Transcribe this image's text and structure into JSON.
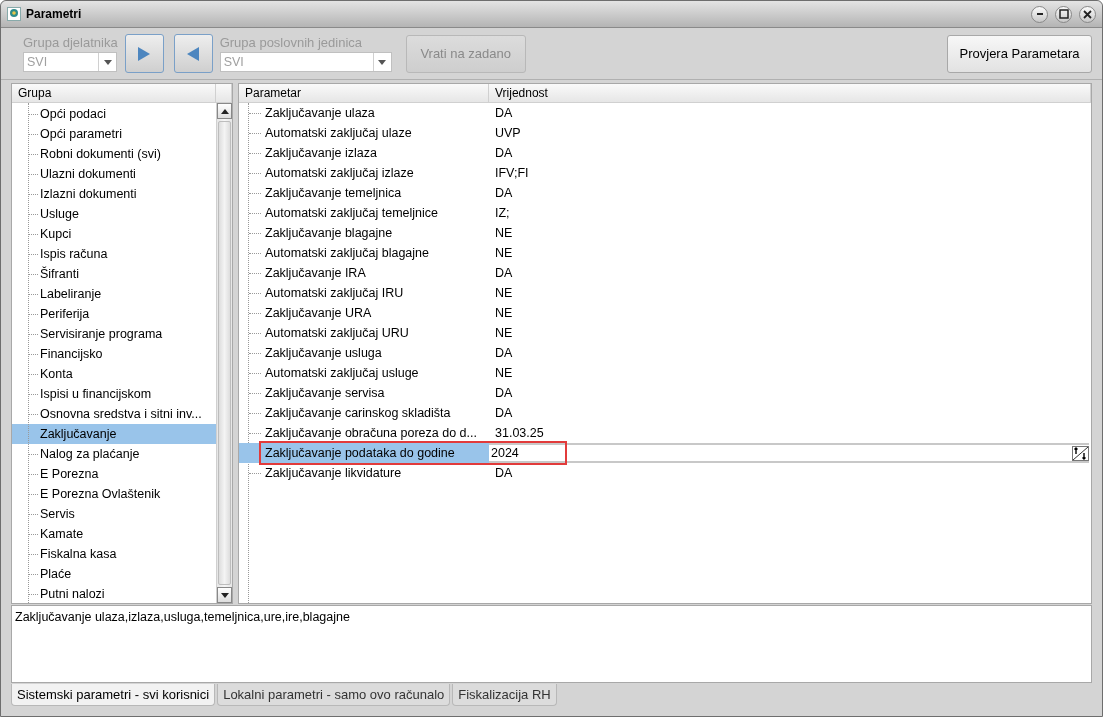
{
  "window": {
    "title": "Parametri"
  },
  "toolbar": {
    "employee_group": {
      "label": "Grupa djelatnika",
      "value": "SVI",
      "disabled": true
    },
    "unit_group": {
      "label": "Grupa poslovnih jedinica",
      "value": "SVI",
      "disabled": true
    },
    "reset_button": {
      "label": "Vrati na zadano",
      "disabled": true
    },
    "check_button": {
      "label": "Provjera Parametara",
      "disabled": false
    }
  },
  "tree": {
    "header": "Grupa",
    "items": [
      {
        "label": "Opći podaci",
        "selected": false
      },
      {
        "label": "Opći parametri",
        "selected": false
      },
      {
        "label": "Robni dokumenti (svi)",
        "selected": false
      },
      {
        "label": "Ulazni dokumenti",
        "selected": false
      },
      {
        "label": "Izlazni dokumenti",
        "selected": false
      },
      {
        "label": "Usluge",
        "selected": false
      },
      {
        "label": "Kupci",
        "selected": false
      },
      {
        "label": "Ispis računa",
        "selected": false
      },
      {
        "label": "Šifranti",
        "selected": false
      },
      {
        "label": "Labeliranje",
        "selected": false
      },
      {
        "label": "Periferija",
        "selected": false
      },
      {
        "label": "Servisiranje programa",
        "selected": false
      },
      {
        "label": "Financijsko",
        "selected": false
      },
      {
        "label": "Konta",
        "selected": false
      },
      {
        "label": "Ispisi u financijskom",
        "selected": false
      },
      {
        "label": "Osnovna sredstva i sitni inv...",
        "selected": false
      },
      {
        "label": "Zaključavanje",
        "selected": true
      },
      {
        "label": "Nalog za plaćanje",
        "selected": false
      },
      {
        "label": "E Porezna",
        "selected": false
      },
      {
        "label": "E Porezna Ovlaštenik",
        "selected": false
      },
      {
        "label": "Servis",
        "selected": false
      },
      {
        "label": "Kamate",
        "selected": false
      },
      {
        "label": "Fiskalna kasa",
        "selected": false
      },
      {
        "label": "Plaće",
        "selected": false
      },
      {
        "label": "Putni nalozi",
        "selected": false
      }
    ]
  },
  "table": {
    "columns": [
      "Parametar",
      "Vrijednost"
    ],
    "rows": [
      {
        "parameter": "Zaključavanje ulaza",
        "value": "DA",
        "selected": false,
        "editing": false
      },
      {
        "parameter": "Automatski zaključaj ulaze",
        "value": "UVP",
        "selected": false,
        "editing": false
      },
      {
        "parameter": "Zaključavanje izlaza",
        "value": "DA",
        "selected": false,
        "editing": false
      },
      {
        "parameter": "Automatski zaključaj izlaze",
        "value": "IFV;FI",
        "selected": false,
        "editing": false
      },
      {
        "parameter": "Zaključavanje temeljnica",
        "value": "DA",
        "selected": false,
        "editing": false
      },
      {
        "parameter": "Automatski zaključaj temeljnice",
        "value": "IZ;",
        "selected": false,
        "editing": false
      },
      {
        "parameter": "Zaključavanje blagajne",
        "value": "NE",
        "selected": false,
        "editing": false
      },
      {
        "parameter": "Automatski zaključaj blagajne",
        "value": "NE",
        "selected": false,
        "editing": false
      },
      {
        "parameter": "Zaključavanje IRA",
        "value": "DA",
        "selected": false,
        "editing": false
      },
      {
        "parameter": "Automatski zaključaj IRU",
        "value": "NE",
        "selected": false,
        "editing": false
      },
      {
        "parameter": "Zaključavanje URA",
        "value": "NE",
        "selected": false,
        "editing": false
      },
      {
        "parameter": "Automatski zaključaj URU",
        "value": "NE",
        "selected": false,
        "editing": false
      },
      {
        "parameter": "Zaključavanje usluga",
        "value": "DA",
        "selected": false,
        "editing": false
      },
      {
        "parameter": "Automatski zaključaj usluge",
        "value": "NE",
        "selected": false,
        "editing": false
      },
      {
        "parameter": "Zaključavanje servisa",
        "value": "DA",
        "selected": false,
        "editing": false
      },
      {
        "parameter": "Zaključavanje carinskog skladišta",
        "value": "DA",
        "selected": false,
        "editing": false
      },
      {
        "parameter": "Zaključavanje obračuna poreza do d...",
        "value": "31.03.25",
        "selected": false,
        "editing": false
      },
      {
        "parameter": "Zaključavanje podataka do godine",
        "value": "2024",
        "selected": true,
        "editing": true,
        "highlighted": true
      },
      {
        "parameter": "Zaključavanje likvidature",
        "value": "DA",
        "selected": false,
        "editing": false
      }
    ]
  },
  "description": "Zaključavanje ulaza,izlaza,usluga,temeljnica,ure,ire,blagajne",
  "tabs": [
    {
      "label": "Sistemski parametri - svi korisnici",
      "selected": true
    },
    {
      "label": "Lokalni parametri - samo ovo računalo",
      "selected": false
    },
    {
      "label": "Fiskalizacija RH",
      "selected": false
    }
  ]
}
